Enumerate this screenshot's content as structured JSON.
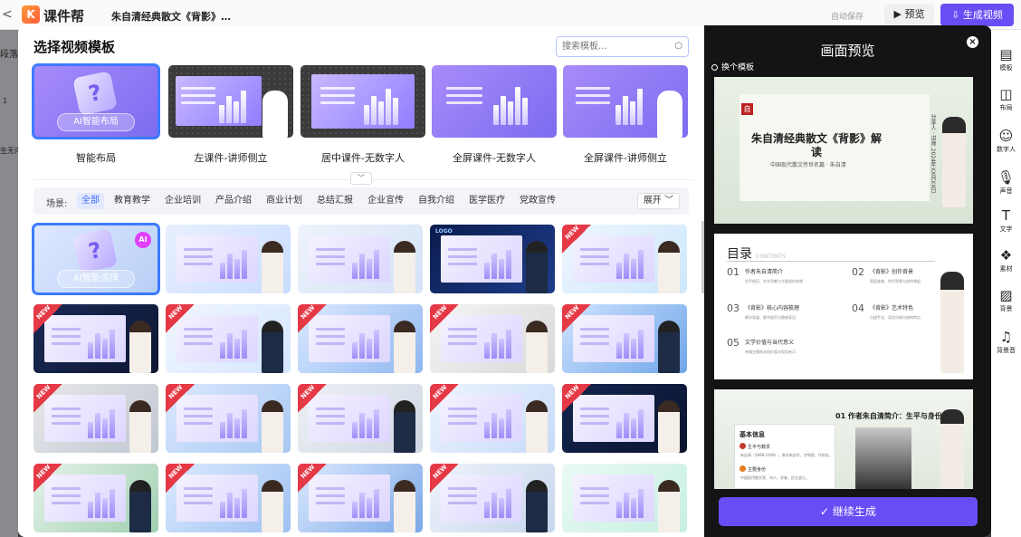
{
  "app": {
    "back": "<",
    "logo_mark": "K",
    "logo_text": "课件帮",
    "doc_title": "朱自清经典散文《背影》…",
    "autosave": "自动保存",
    "preview": "预览",
    "generate": "生成视频",
    "left_fragments": [
      "段落 (",
      "1",
      "生无内"
    ]
  },
  "modal": {
    "title": "选择视频模板",
    "search_placeholder": "搜索模板...",
    "layouts": [
      {
        "label": "智能布局",
        "badge": "AI智能布局",
        "selected": true
      },
      {
        "label": "左课件-讲师侧立"
      },
      {
        "label": "居中课件-无数字人"
      },
      {
        "label": "全屏课件-无数字人"
      },
      {
        "label": "全屏课件-讲师侧立"
      }
    ],
    "filter_label": "场景:",
    "categories": [
      "全部",
      "教育教学",
      "企业培训",
      "产品介绍",
      "商业计划",
      "总结汇报",
      "企业宣传",
      "自我介绍",
      "医学医疗",
      "党政宣传"
    ],
    "expand": "展开",
    "ai_select": "AI智能选择",
    "ai_tag": "AI",
    "new_tag": "NEW",
    "logo_tag": "LOGO"
  },
  "preview": {
    "title": "画面预览",
    "close": "×",
    "swap_template": "换个模板",
    "slide1": {
      "mark": "自",
      "title": "朱自清经典散文《背影》解读",
      "subtitle": "中国现代散文传世名篇 · 朱自清",
      "vertical": "分享人 · 讲师 2024年XX月XX日"
    },
    "slide2": {
      "heading": "目录",
      "heading_en": "CONTENTS",
      "items": [
        {
          "num": "01",
          "title": "作者朱自清简介",
          "desc": "生平经历、文学贡献与主要创作成就"
        },
        {
          "num": "02",
          "title": "《背影》创作背景",
          "desc": "家庭变故、时代背景与创作缘起"
        },
        {
          "num": "03",
          "title": "《背影》核心内容梳理",
          "desc": "情节发展、细节描写与情感表达"
        },
        {
          "num": "04",
          "title": "《背影》艺术特色",
          "desc": "白描手法、语言风格与结构特点"
        },
        {
          "num": "05",
          "title": "文学价值与当代意义",
          "desc": "亲情主题的永恒价值与现实启示"
        }
      ]
    },
    "slide3": {
      "heading": "01 作者朱自清简介：生平与身份",
      "box_title": "基本信息",
      "row1": "生平与籍贯",
      "row1_desc": "朱自清（1898-1948），原名朱自华，字佩弦，号秋实。",
      "row2": "主要身份",
      "row2_desc": "中国现代散文家、诗人、学者、民主战士。"
    },
    "continue": "继续生成"
  },
  "toolbar": [
    {
      "icon": "template-icon",
      "glyph": "▤",
      "label": "模板"
    },
    {
      "icon": "layout-icon",
      "glyph": "◫",
      "label": "布局"
    },
    {
      "icon": "avatar-icon",
      "glyph": "☺",
      "label": "数字人"
    },
    {
      "icon": "mic-icon",
      "glyph": "🎙",
      "label": "声音"
    },
    {
      "icon": "text-icon",
      "glyph": "T",
      "label": "文字"
    },
    {
      "icon": "material-icon",
      "glyph": "❖",
      "label": "素材"
    },
    {
      "icon": "background-icon",
      "glyph": "▨",
      "label": "背景"
    },
    {
      "icon": "music-icon",
      "glyph": "♫",
      "label": "背景音"
    }
  ],
  "colors": {
    "accent": "#6a4cf5",
    "selected": "#3d7bff",
    "new_tag": "#e63946"
  }
}
